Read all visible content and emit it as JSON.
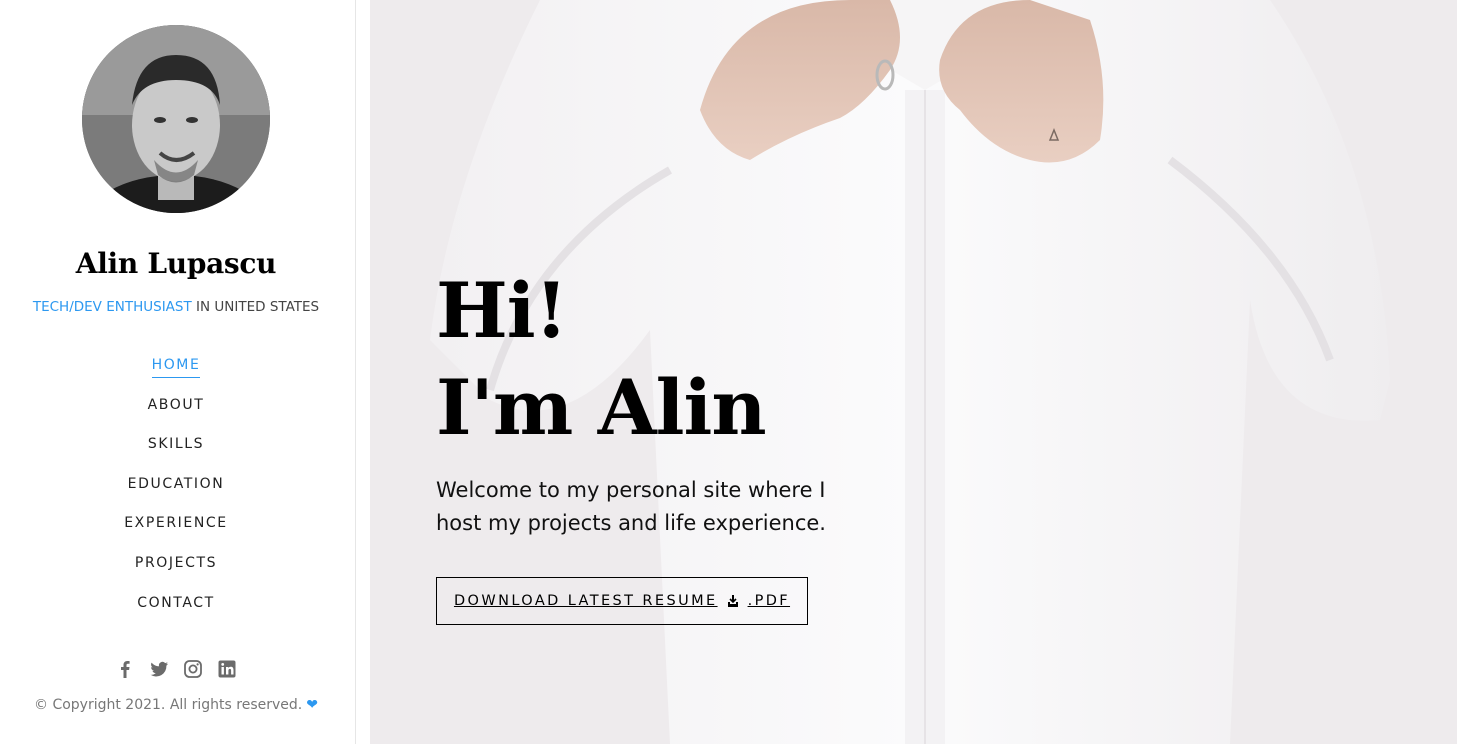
{
  "profile": {
    "name": "Alin Lupascu",
    "role_accent": "TECH/DEV ENTHUSIAST",
    "role_rest": " IN UNITED STATES"
  },
  "nav": {
    "items": [
      {
        "label": "HOME",
        "active": true
      },
      {
        "label": "ABOUT"
      },
      {
        "label": "SKILLS"
      },
      {
        "label": "EDUCATION"
      },
      {
        "label": "EXPERIENCE"
      },
      {
        "label": "PROJECTS"
      },
      {
        "label": "CONTACT"
      }
    ]
  },
  "social": {
    "icons": [
      "facebook-icon",
      "twitter-icon",
      "instagram-icon",
      "linkedin-icon"
    ]
  },
  "footer": {
    "copyright": "© Copyright 2021. All rights reserved.",
    "heart": "❤"
  },
  "hero": {
    "line1": "Hi!",
    "line2": "I'm Alin",
    "text": "Welcome to my personal site where I host my projects and life experience.",
    "button_left": "DOWNLOAD LATEST RESUME",
    "button_right": ".PDF"
  },
  "colors": {
    "accent": "#2c98f0",
    "text": "#111111",
    "hero_bg": "#eeebed"
  }
}
